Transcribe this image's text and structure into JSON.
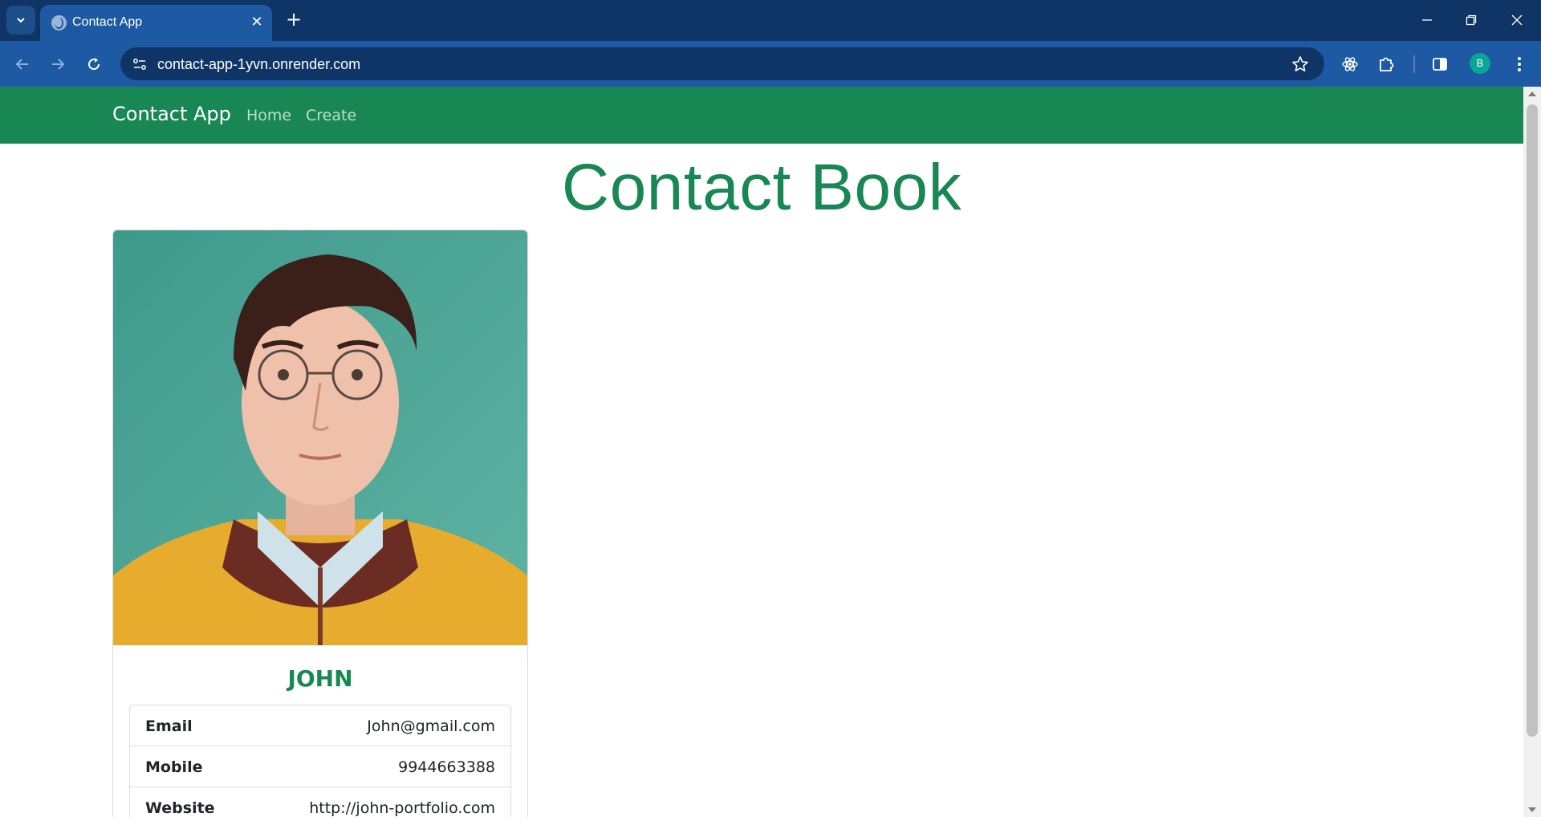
{
  "browser": {
    "tab_title": "Contact App",
    "url": "contact-app-1yvn.onrender.com",
    "profile_initial": "B",
    "colors": {
      "frame": "#0e3566",
      "toolbar": "#1d5aa3",
      "avatar": "#0aa596"
    }
  },
  "navbar": {
    "brand": "Contact App",
    "links": [
      "Home",
      "Create"
    ],
    "color": "#198754"
  },
  "page": {
    "title": "Contact Book"
  },
  "contact": {
    "name": "JOHN",
    "fields": [
      {
        "label": "Email",
        "value": "John@gmail.com"
      },
      {
        "label": "Mobile",
        "value": "9944663388"
      },
      {
        "label": "Website",
        "value": "http://john-portfolio.com"
      }
    ]
  }
}
